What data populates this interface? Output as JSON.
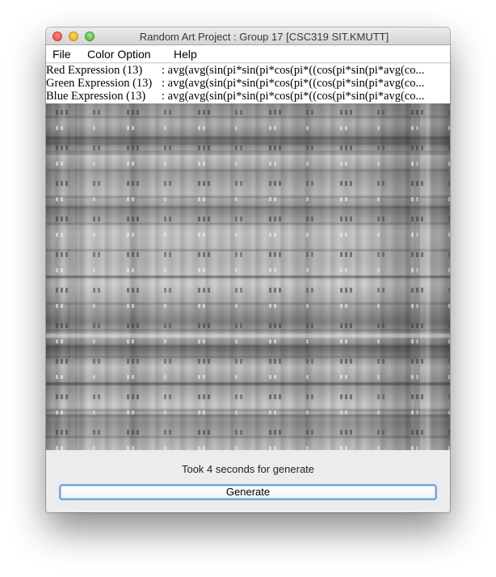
{
  "window": {
    "title": "Random Art Project : Group 17 [CSC319 SIT.KMUTT]"
  },
  "menubar": {
    "items": [
      "File",
      "Color Option",
      "Help"
    ]
  },
  "expressions": [
    {
      "label": "Red Expression (13)",
      "value": ": avg(avg(sin(pi*sin(pi*cos(pi*((cos(pi*sin(pi*avg(co..."
    },
    {
      "label": "Green Expression (13)",
      "value": ": avg(avg(sin(pi*sin(pi*cos(pi*((cos(pi*sin(pi*avg(co..."
    },
    {
      "label": "Blue Expression (13)",
      "value": ": avg(avg(sin(pi*sin(pi*cos(pi*((cos(pi*sin(pi*avg(co..."
    }
  ],
  "status": {
    "text": "Took 4 seconds for generate"
  },
  "generate_button": {
    "label": "Generate"
  },
  "colors": {
    "button_focus_ring": "#6fa6e4",
    "window_background": "#ececec"
  }
}
